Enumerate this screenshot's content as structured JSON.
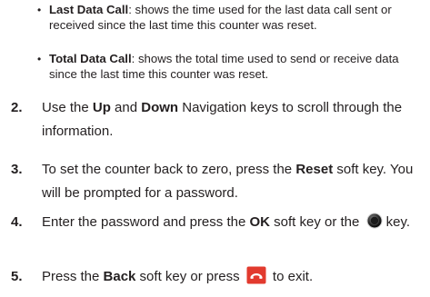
{
  "bullets": [
    {
      "title": "Last Data Call",
      "text": ": shows the time used for the last data call sent or received since the last time this counter was reset."
    },
    {
      "title": "Total Data Call",
      "text": ": shows the total time used to send or receive data since the last time this counter was reset."
    }
  ],
  "steps": {
    "s2": {
      "num": "2.",
      "a": "Use the ",
      "b1": "Up",
      "c": " and ",
      "b2": "Down",
      "d": " Navigation keys to scroll through the information."
    },
    "s3": {
      "num": "3.",
      "a": "To set the counter back to zero, press the ",
      "b1": "Reset",
      "c": " soft key. You will be prompted for a password."
    },
    "s4": {
      "num": "4.",
      "a": "Enter the password and press the ",
      "b1": "OK",
      "c": " soft key or the ",
      "icon": "select-key-icon",
      "d": " key."
    },
    "s5": {
      "num": "5.",
      "a": "Press the ",
      "b1": "Back",
      "c": " soft key or press ",
      "icon": "end-key-icon",
      "d": " to exit."
    }
  },
  "colors": {
    "text": "#231f20",
    "end_key_bg": "#e23a2e"
  }
}
